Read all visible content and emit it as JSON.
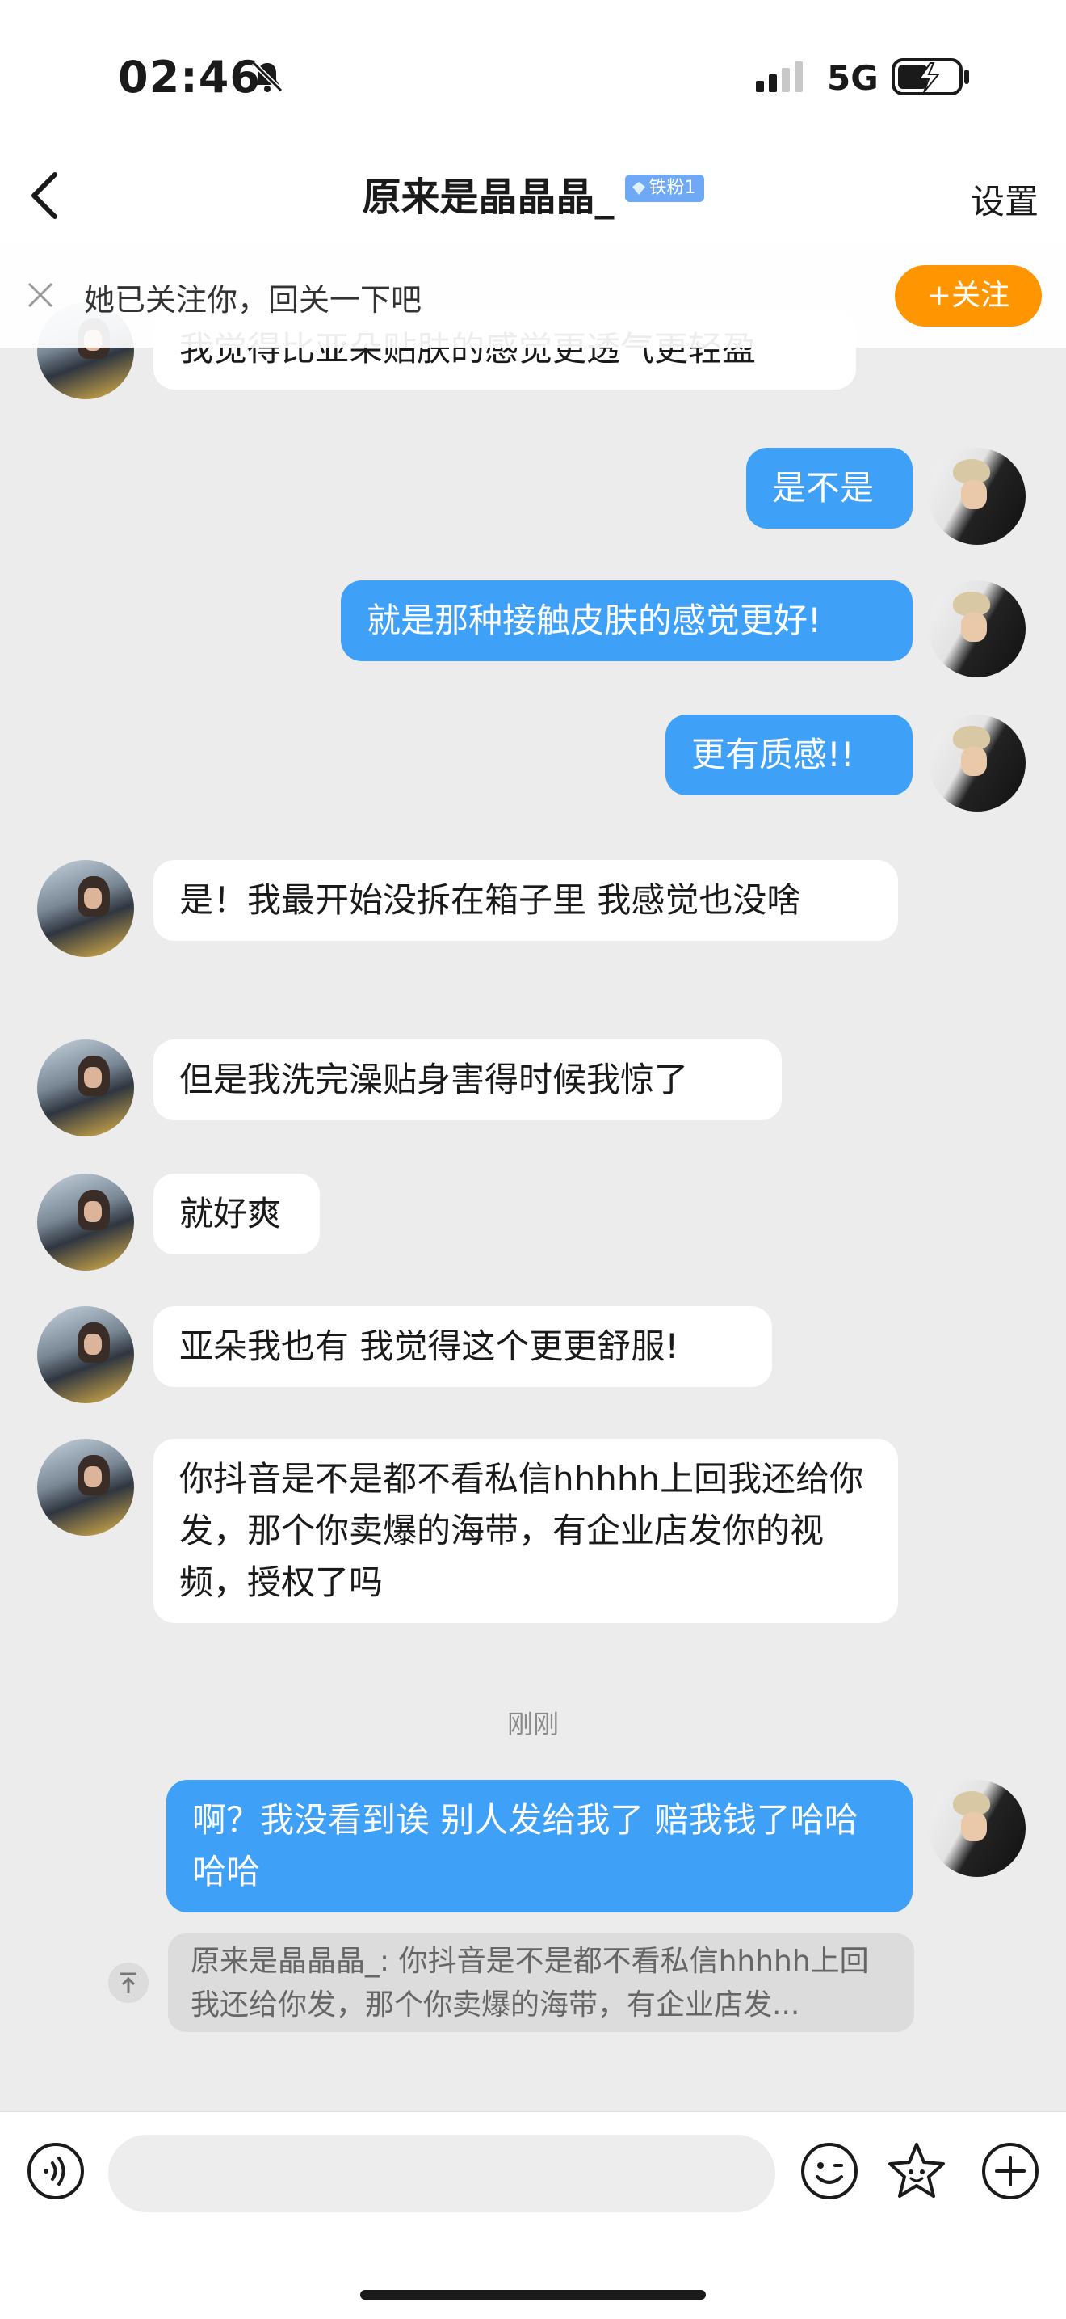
{
  "status_bar": {
    "time": "02:46",
    "network": "5G"
  },
  "nav": {
    "title": "原来是晶晶晶_",
    "badge": "铁粉1",
    "settings_label": "设置"
  },
  "follow_banner": {
    "text": "她已关注你，回关一下吧",
    "button_label": "+关注",
    "accent_color": "#ff9500"
  },
  "messages": [
    {
      "side": "in",
      "text": "我觉得比亚朵贴肤的感觉更透气更轻盈"
    },
    {
      "side": "out",
      "text": "是不是"
    },
    {
      "side": "out",
      "text": "就是那种接触皮肤的感觉更好!"
    },
    {
      "side": "out",
      "text": "更有质感!!"
    },
    {
      "side": "in",
      "text": "是！我最开始没拆在箱子里 我感觉也没啥"
    },
    {
      "side": "in",
      "text": "但是我洗完澡贴身害得时候我惊了"
    },
    {
      "side": "in",
      "text": "就好爽"
    },
    {
      "side": "in",
      "text": "亚朵我也有 我觉得这个更更舒服!"
    },
    {
      "side": "in",
      "text": "你抖音是不是都不看私信hhhhh上回我还给你发，那个你卖爆的海带，有企业店发你的视频，授权了吗"
    },
    {
      "side": "out",
      "text": "啊？我没看到诶 别人发给我了 赔我钱了哈哈哈哈"
    }
  ],
  "timestamp": "刚刚",
  "quote": {
    "text": "原来是晶晶晶_: 你抖音是不是都不看私信hhhhh上回我还给你发，那个你卖爆的海带，有企业店发..."
  },
  "input_bar": {
    "placeholder": ""
  },
  "colors": {
    "outgoing_bubble": "#3fa0f7",
    "incoming_bubble": "#ffffff",
    "background": "#ececec"
  },
  "icons": [
    "bell-slash-icon",
    "signal-icon",
    "battery-charging-icon",
    "back-arrow-icon",
    "gem-icon",
    "close-icon",
    "voice-icon",
    "emoji-icon",
    "sticker-icon",
    "plus-icon"
  ]
}
